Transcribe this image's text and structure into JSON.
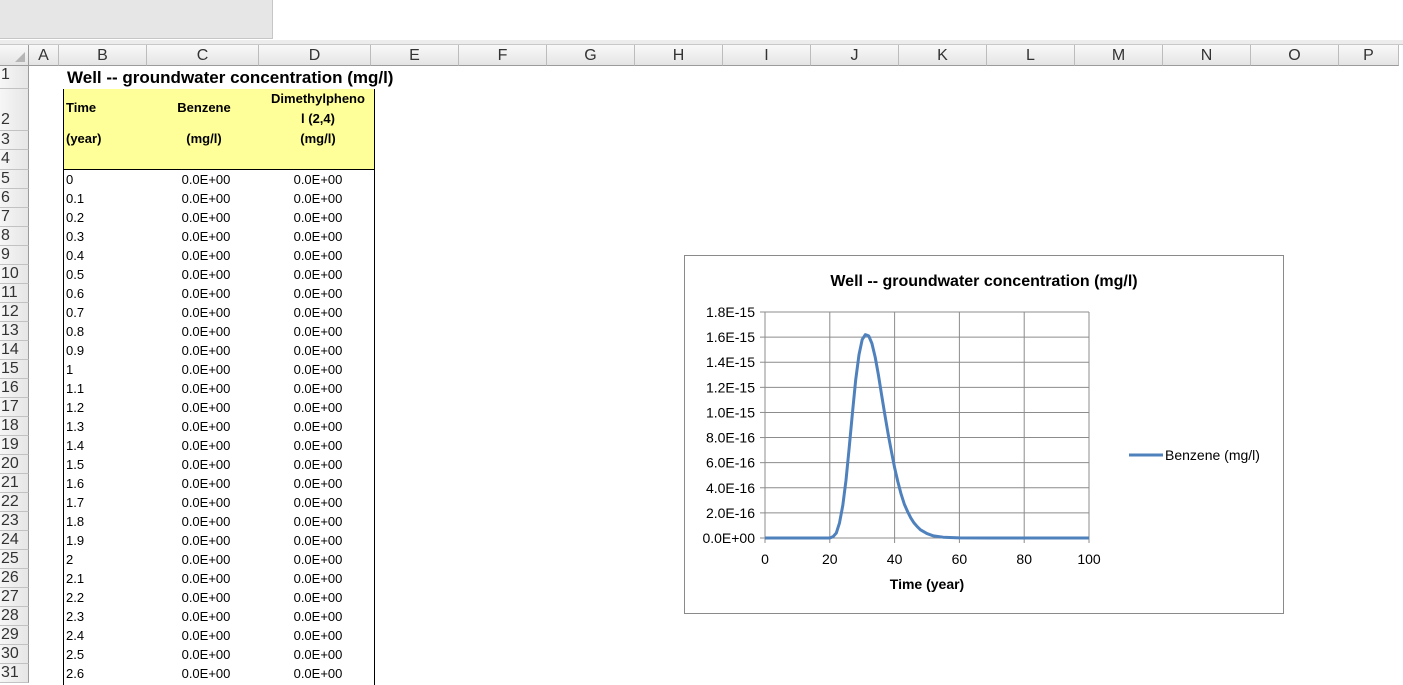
{
  "columns": [
    "A",
    "B",
    "C",
    "D",
    "E",
    "F",
    "G",
    "H",
    "I",
    "J",
    "K",
    "L",
    "M",
    "N",
    "O",
    "P"
  ],
  "rows": [
    "1",
    "2",
    "3",
    "4",
    "5",
    "6",
    "7",
    "8",
    "9",
    "10",
    "11",
    "12",
    "13",
    "14",
    "15",
    "16",
    "17",
    "18",
    "19",
    "20",
    "21",
    "22",
    "23",
    "24",
    "25",
    "26",
    "27",
    "28",
    "29",
    "30",
    "31"
  ],
  "sheet": {
    "title": "Well -- groundwater concentration (mg/l)",
    "headers": {
      "time": "Time",
      "time_unit": "(year)",
      "benzene": "Benzene",
      "benzene_unit": "(mg/l)",
      "dmp_line1": "Dimethylpheno",
      "dmp_line2": "l (2,4)",
      "dmp_unit": "(mg/l)"
    },
    "data_rows": [
      [
        "0",
        "0.0E+00",
        "0.0E+00"
      ],
      [
        "0.1",
        "0.0E+00",
        "0.0E+00"
      ],
      [
        "0.2",
        "0.0E+00",
        "0.0E+00"
      ],
      [
        "0.3",
        "0.0E+00",
        "0.0E+00"
      ],
      [
        "0.4",
        "0.0E+00",
        "0.0E+00"
      ],
      [
        "0.5",
        "0.0E+00",
        "0.0E+00"
      ],
      [
        "0.6",
        "0.0E+00",
        "0.0E+00"
      ],
      [
        "0.7",
        "0.0E+00",
        "0.0E+00"
      ],
      [
        "0.8",
        "0.0E+00",
        "0.0E+00"
      ],
      [
        "0.9",
        "0.0E+00",
        "0.0E+00"
      ],
      [
        "1",
        "0.0E+00",
        "0.0E+00"
      ],
      [
        "1.1",
        "0.0E+00",
        "0.0E+00"
      ],
      [
        "1.2",
        "0.0E+00",
        "0.0E+00"
      ],
      [
        "1.3",
        "0.0E+00",
        "0.0E+00"
      ],
      [
        "1.4",
        "0.0E+00",
        "0.0E+00"
      ],
      [
        "1.5",
        "0.0E+00",
        "0.0E+00"
      ],
      [
        "1.6",
        "0.0E+00",
        "0.0E+00"
      ],
      [
        "1.7",
        "0.0E+00",
        "0.0E+00"
      ],
      [
        "1.8",
        "0.0E+00",
        "0.0E+00"
      ],
      [
        "1.9",
        "0.0E+00",
        "0.0E+00"
      ],
      [
        "2",
        "0.0E+00",
        "0.0E+00"
      ],
      [
        "2.1",
        "0.0E+00",
        "0.0E+00"
      ],
      [
        "2.2",
        "0.0E+00",
        "0.0E+00"
      ],
      [
        "2.3",
        "0.0E+00",
        "0.0E+00"
      ],
      [
        "2.4",
        "0.0E+00",
        "0.0E+00"
      ],
      [
        "2.5",
        "0.0E+00",
        "0.0E+00"
      ],
      [
        "2.6",
        "0.0E+00",
        "0.0E+00"
      ]
    ]
  },
  "chart_data": {
    "type": "line",
    "title": "Well -- groundwater concentration (mg/l)",
    "xlabel": "Time (year)",
    "ylabel": "",
    "xlim": [
      0,
      100
    ],
    "ylim": [
      0,
      1.8e-15
    ],
    "x_ticks": [
      "0",
      "20",
      "40",
      "60",
      "80",
      "100"
    ],
    "y_ticks": [
      "0.0E+00",
      "2.0E-16",
      "4.0E-16",
      "6.0E-16",
      "8.0E-16",
      "1.0E-15",
      "1.2E-15",
      "1.4E-15",
      "1.6E-15",
      "1.8E-15"
    ],
    "grid": true,
    "legend": "right",
    "series": [
      {
        "name": "Benzene (mg/l)",
        "color": "#4f81bd",
        "x": [
          0,
          20,
          21,
          22,
          23,
          24,
          25,
          26,
          27,
          28,
          29,
          30,
          31,
          32,
          33,
          34,
          35,
          36,
          37,
          38,
          39,
          40,
          41,
          42,
          43,
          44,
          45,
          46,
          47,
          48,
          50,
          52,
          55,
          60,
          70,
          100
        ],
        "y": [
          0,
          0,
          1e-17,
          4e-17,
          1.2e-16,
          2.6e-16,
          4.6e-16,
          7.2e-16,
          1e-15,
          1.26e-15,
          1.46e-15,
          1.58e-15,
          1.62e-15,
          1.61e-15,
          1.55e-15,
          1.44e-15,
          1.3e-15,
          1.14e-15,
          9.8e-16,
          8.3e-16,
          6.9e-16,
          5.6e-16,
          4.5e-16,
          3.5e-16,
          2.7e-16,
          2.1e-16,
          1.6e-16,
          1.2e-16,
          9e-17,
          6.5e-17,
          3.5e-17,
          1.7e-17,
          6e-18,
          1e-18,
          0,
          0
        ]
      }
    ]
  }
}
